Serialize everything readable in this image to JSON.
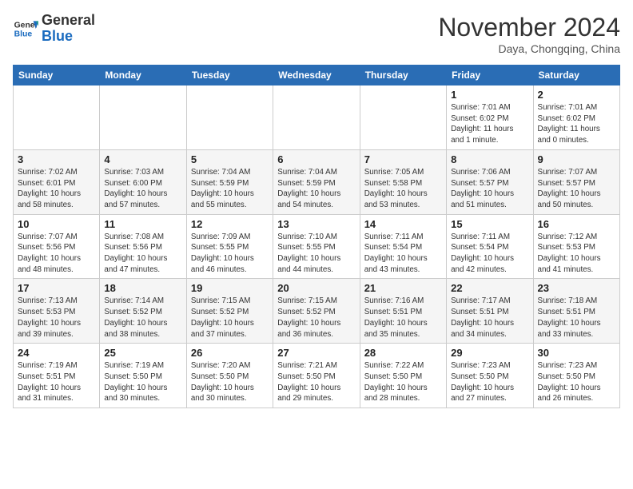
{
  "header": {
    "logo_general": "General",
    "logo_blue": "Blue",
    "month_title": "November 2024",
    "location": "Daya, Chongqing, China"
  },
  "weekdays": [
    "Sunday",
    "Monday",
    "Tuesday",
    "Wednesday",
    "Thursday",
    "Friday",
    "Saturday"
  ],
  "weeks": [
    [
      {
        "day": "",
        "info": ""
      },
      {
        "day": "",
        "info": ""
      },
      {
        "day": "",
        "info": ""
      },
      {
        "day": "",
        "info": ""
      },
      {
        "day": "",
        "info": ""
      },
      {
        "day": "1",
        "info": "Sunrise: 7:01 AM\nSunset: 6:02 PM\nDaylight: 11 hours\nand 1 minute."
      },
      {
        "day": "2",
        "info": "Sunrise: 7:01 AM\nSunset: 6:02 PM\nDaylight: 11 hours\nand 0 minutes."
      }
    ],
    [
      {
        "day": "3",
        "info": "Sunrise: 7:02 AM\nSunset: 6:01 PM\nDaylight: 10 hours\nand 58 minutes."
      },
      {
        "day": "4",
        "info": "Sunrise: 7:03 AM\nSunset: 6:00 PM\nDaylight: 10 hours\nand 57 minutes."
      },
      {
        "day": "5",
        "info": "Sunrise: 7:04 AM\nSunset: 5:59 PM\nDaylight: 10 hours\nand 55 minutes."
      },
      {
        "day": "6",
        "info": "Sunrise: 7:04 AM\nSunset: 5:59 PM\nDaylight: 10 hours\nand 54 minutes."
      },
      {
        "day": "7",
        "info": "Sunrise: 7:05 AM\nSunset: 5:58 PM\nDaylight: 10 hours\nand 53 minutes."
      },
      {
        "day": "8",
        "info": "Sunrise: 7:06 AM\nSunset: 5:57 PM\nDaylight: 10 hours\nand 51 minutes."
      },
      {
        "day": "9",
        "info": "Sunrise: 7:07 AM\nSunset: 5:57 PM\nDaylight: 10 hours\nand 50 minutes."
      }
    ],
    [
      {
        "day": "10",
        "info": "Sunrise: 7:07 AM\nSunset: 5:56 PM\nDaylight: 10 hours\nand 48 minutes."
      },
      {
        "day": "11",
        "info": "Sunrise: 7:08 AM\nSunset: 5:56 PM\nDaylight: 10 hours\nand 47 minutes."
      },
      {
        "day": "12",
        "info": "Sunrise: 7:09 AM\nSunset: 5:55 PM\nDaylight: 10 hours\nand 46 minutes."
      },
      {
        "day": "13",
        "info": "Sunrise: 7:10 AM\nSunset: 5:55 PM\nDaylight: 10 hours\nand 44 minutes."
      },
      {
        "day": "14",
        "info": "Sunrise: 7:11 AM\nSunset: 5:54 PM\nDaylight: 10 hours\nand 43 minutes."
      },
      {
        "day": "15",
        "info": "Sunrise: 7:11 AM\nSunset: 5:54 PM\nDaylight: 10 hours\nand 42 minutes."
      },
      {
        "day": "16",
        "info": "Sunrise: 7:12 AM\nSunset: 5:53 PM\nDaylight: 10 hours\nand 41 minutes."
      }
    ],
    [
      {
        "day": "17",
        "info": "Sunrise: 7:13 AM\nSunset: 5:53 PM\nDaylight: 10 hours\nand 39 minutes."
      },
      {
        "day": "18",
        "info": "Sunrise: 7:14 AM\nSunset: 5:52 PM\nDaylight: 10 hours\nand 38 minutes."
      },
      {
        "day": "19",
        "info": "Sunrise: 7:15 AM\nSunset: 5:52 PM\nDaylight: 10 hours\nand 37 minutes."
      },
      {
        "day": "20",
        "info": "Sunrise: 7:15 AM\nSunset: 5:52 PM\nDaylight: 10 hours\nand 36 minutes."
      },
      {
        "day": "21",
        "info": "Sunrise: 7:16 AM\nSunset: 5:51 PM\nDaylight: 10 hours\nand 35 minutes."
      },
      {
        "day": "22",
        "info": "Sunrise: 7:17 AM\nSunset: 5:51 PM\nDaylight: 10 hours\nand 34 minutes."
      },
      {
        "day": "23",
        "info": "Sunrise: 7:18 AM\nSunset: 5:51 PM\nDaylight: 10 hours\nand 33 minutes."
      }
    ],
    [
      {
        "day": "24",
        "info": "Sunrise: 7:19 AM\nSunset: 5:51 PM\nDaylight: 10 hours\nand 31 minutes."
      },
      {
        "day": "25",
        "info": "Sunrise: 7:19 AM\nSunset: 5:50 PM\nDaylight: 10 hours\nand 30 minutes."
      },
      {
        "day": "26",
        "info": "Sunrise: 7:20 AM\nSunset: 5:50 PM\nDaylight: 10 hours\nand 30 minutes."
      },
      {
        "day": "27",
        "info": "Sunrise: 7:21 AM\nSunset: 5:50 PM\nDaylight: 10 hours\nand 29 minutes."
      },
      {
        "day": "28",
        "info": "Sunrise: 7:22 AM\nSunset: 5:50 PM\nDaylight: 10 hours\nand 28 minutes."
      },
      {
        "day": "29",
        "info": "Sunrise: 7:23 AM\nSunset: 5:50 PM\nDaylight: 10 hours\nand 27 minutes."
      },
      {
        "day": "30",
        "info": "Sunrise: 7:23 AM\nSunset: 5:50 PM\nDaylight: 10 hours\nand 26 minutes."
      }
    ]
  ]
}
